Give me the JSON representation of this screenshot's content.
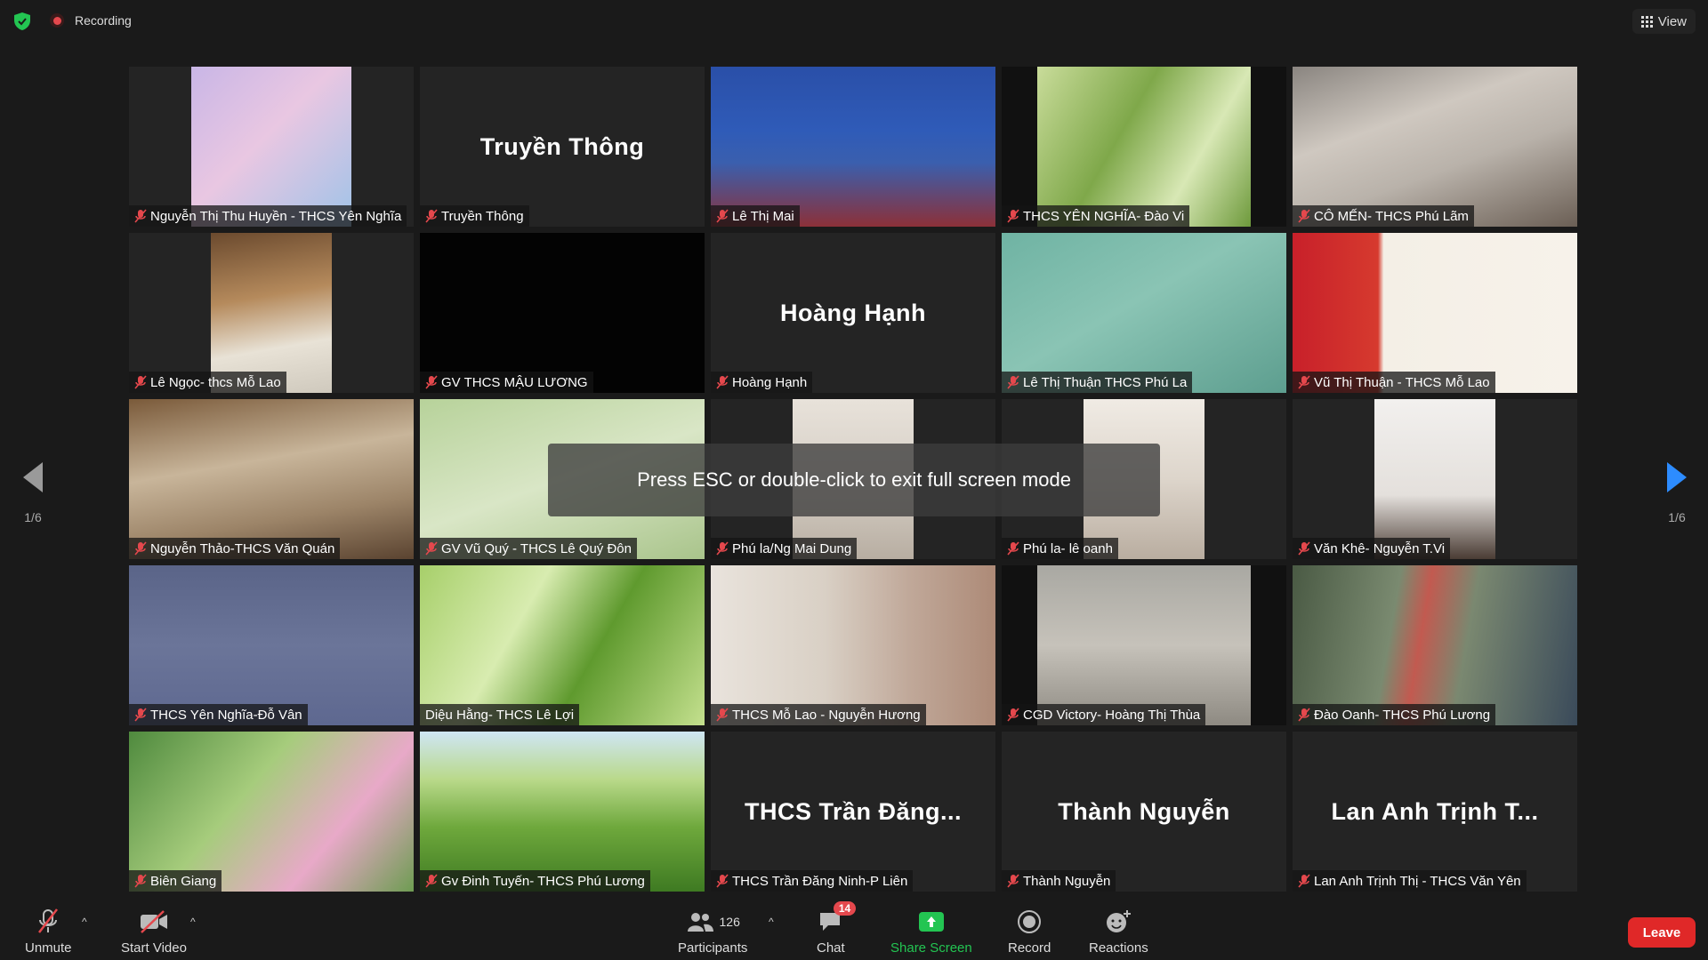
{
  "topbar": {
    "recording_label": "Recording",
    "view_label": "View"
  },
  "overlay": {
    "message": "Press ESC or double-click to exit full screen mode"
  },
  "pager": {
    "left_page": "1/6",
    "right_page": "1/6"
  },
  "tiles": [
    {
      "name": "Nguyễn Thị Thu Huyền - THCS Yên Nghĩa",
      "kind": "video",
      "muted": true
    },
    {
      "name": "Truyền Thông",
      "kind": "name",
      "big_name": "Truyền Thông",
      "muted": true
    },
    {
      "name": "Lê Thị Mai",
      "kind": "video",
      "muted": true
    },
    {
      "name": "THCS YÊN NGHĨA- Đào Vi",
      "kind": "video",
      "muted": true
    },
    {
      "name": "CÔ MẾN- THCS Phú Lãm",
      "kind": "video",
      "muted": true
    },
    {
      "name": "Lê Ngọc- thcs Mỗ Lao",
      "kind": "video",
      "muted": true
    },
    {
      "name": "GV THCS MẬU LƯƠNG",
      "kind": "video",
      "muted": true
    },
    {
      "name": "Hoàng Hạnh",
      "kind": "name",
      "big_name": "Hoàng Hạnh",
      "muted": true
    },
    {
      "name": "Lê Thị Thuận THCS Phú La",
      "kind": "video",
      "muted": true
    },
    {
      "name": "Vũ Thị Thuận - THCS Mỗ Lao",
      "kind": "video",
      "muted": true
    },
    {
      "name": "Nguyễn Thảo-THCS Văn Quán",
      "kind": "video",
      "muted": true
    },
    {
      "name": "GV Vũ Quý - THCS Lê Quý Đôn",
      "kind": "video",
      "muted": true
    },
    {
      "name": "Phú la/Ng Mai Dung",
      "kind": "video",
      "muted": true
    },
    {
      "name": "Phú la- lê oanh",
      "kind": "video",
      "muted": true
    },
    {
      "name": "Văn Khê- Nguyễn T.Vi",
      "kind": "video",
      "muted": true
    },
    {
      "name": "THCS Yên Nghĩa-Đỗ Vân",
      "kind": "video",
      "muted": true
    },
    {
      "name": "Diệu Hằng- THCS Lê Lợi",
      "kind": "video",
      "muted": false,
      "active": true
    },
    {
      "name": "THCS Mỗ Lao - Nguyễn Hương",
      "kind": "video",
      "muted": true
    },
    {
      "name": "CGD Victory- Hoàng Thị Thùa",
      "kind": "video",
      "muted": true
    },
    {
      "name": "Đào Oanh- THCS Phú Lương",
      "kind": "video",
      "muted": true
    },
    {
      "name": "Biên Giang",
      "kind": "video",
      "muted": true
    },
    {
      "name": "Gv Đinh Tuyến- THCS Phú Lương",
      "kind": "video",
      "muted": true
    },
    {
      "name": "THCS Trần Đăng Ninh-P Liên",
      "kind": "name",
      "big_name": "THCS Trần Đăng...",
      "muted": true
    },
    {
      "name": "Thành Nguyễn",
      "kind": "name",
      "big_name": "Thành Nguyễn",
      "muted": true
    },
    {
      "name": "Lan Anh Trịnh Thị - THCS Văn Yên",
      "kind": "name",
      "big_name": "Lan Anh Trịnh T...",
      "muted": true
    }
  ],
  "toolbar": {
    "unmute": "Unmute",
    "start_video": "Start Video",
    "participants": "Participants",
    "participants_count": "126",
    "chat": "Chat",
    "chat_badge": "14",
    "share_screen": "Share Screen",
    "record": "Record",
    "reactions": "Reactions",
    "leave": "Leave"
  }
}
